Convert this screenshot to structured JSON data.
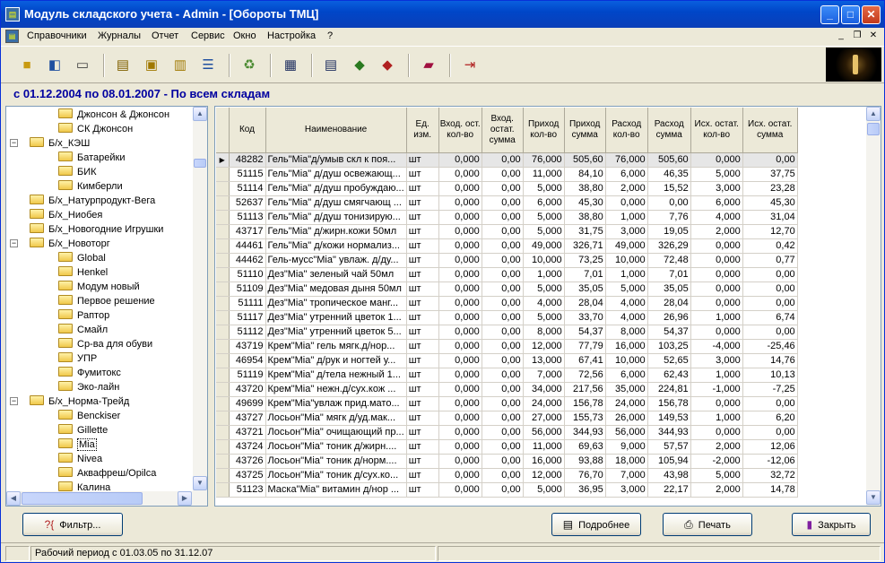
{
  "window": {
    "title": "Модуль складского учета - Admin - [Обороты ТМЦ]"
  },
  "menu": [
    "Справочники",
    "Журналы",
    "Отчет",
    "Сервис",
    "Окно",
    "Настройка",
    "?"
  ],
  "period": "с 01.12.2004 по 08.01.2007 - По всем складам",
  "tree": [
    {
      "label": "Джонсон & Джонсон",
      "level": 3,
      "folder": true
    },
    {
      "label": "СК Джонсон",
      "level": 3,
      "folder": true
    },
    {
      "label": "Б/х_КЭШ",
      "level": 2,
      "folder": true,
      "expander": "−"
    },
    {
      "label": "Батарейки",
      "level": 3,
      "folder": true
    },
    {
      "label": "БИК",
      "level": 3,
      "folder": true
    },
    {
      "label": "Кимберли",
      "level": 3,
      "folder": true
    },
    {
      "label": "Б/х_Натурпродукт-Вега",
      "level": 2,
      "folder": true
    },
    {
      "label": "Б/х_Ниобея",
      "level": 2,
      "folder": true
    },
    {
      "label": "Б/х_Новогодние Игрушки",
      "level": 2,
      "folder": true
    },
    {
      "label": "Б/х_Новоторг",
      "level": 2,
      "folder": true,
      "expander": "−"
    },
    {
      "label": "Global",
      "level": 3,
      "folder": true
    },
    {
      "label": "Henkel",
      "level": 3,
      "folder": true
    },
    {
      "label": "Модум новый",
      "level": 3,
      "folder": true
    },
    {
      "label": "Первое решение",
      "level": 3,
      "folder": true
    },
    {
      "label": "Раптор",
      "level": 3,
      "folder": true
    },
    {
      "label": "Смайл",
      "level": 3,
      "folder": true
    },
    {
      "label": "Ср-ва для обуви",
      "level": 3,
      "folder": true
    },
    {
      "label": "УПР",
      "level": 3,
      "folder": true
    },
    {
      "label": "Фумитокс",
      "level": 3,
      "folder": true
    },
    {
      "label": "Эко-лайн",
      "level": 3,
      "folder": true
    },
    {
      "label": "Б/х_Норма-Трейд",
      "level": 2,
      "folder": true,
      "expander": "−"
    },
    {
      "label": "Benckiser",
      "level": 3,
      "folder": true
    },
    {
      "label": "Gillette",
      "level": 3,
      "folder": true
    },
    {
      "label": "Mia",
      "level": 3,
      "folder": true,
      "selected": true
    },
    {
      "label": "Nivea",
      "level": 3,
      "folder": true
    },
    {
      "label": "Аквафреш/Opilca",
      "level": 3,
      "folder": true
    },
    {
      "label": "Калина",
      "level": 3,
      "folder": true
    }
  ],
  "table": {
    "columns": [
      "Код",
      "Наименование",
      "Ед. изм.",
      "Вход. ост. кол-во",
      "Вход. остат. сумма",
      "Приход кол-во",
      "Приход сумма",
      "Расход кол-во",
      "Расход сумма",
      "Исх. остат. кол-во",
      "Исх. остат. сумма"
    ],
    "rows": [
      [
        "48282",
        "Гель\"Mia\"д/умыв скл к поя...",
        "шт",
        "0,000",
        "0,00",
        "76,000",
        "505,60",
        "76,000",
        "505,60",
        "0,000",
        "0,00"
      ],
      [
        "51115",
        "Гель\"Mia\" д/душ освежающ...",
        "шт",
        "0,000",
        "0,00",
        "11,000",
        "84,10",
        "6,000",
        "46,35",
        "5,000",
        "37,75"
      ],
      [
        "51114",
        "Гель\"Mia\" д/душ пробуждаю...",
        "шт",
        "0,000",
        "0,00",
        "5,000",
        "38,80",
        "2,000",
        "15,52",
        "3,000",
        "23,28"
      ],
      [
        "52637",
        "Гель\"Mia\" д/душ смягчающ ...",
        "шт",
        "0,000",
        "0,00",
        "6,000",
        "45,30",
        "0,000",
        "0,00",
        "6,000",
        "45,30"
      ],
      [
        "51113",
        "Гель\"Mia\" д/душ тонизирую...",
        "шт",
        "0,000",
        "0,00",
        "5,000",
        "38,80",
        "1,000",
        "7,76",
        "4,000",
        "31,04"
      ],
      [
        "43717",
        "Гель\"Mia\" д/жирн.кожи 50мл",
        "шт",
        "0,000",
        "0,00",
        "5,000",
        "31,75",
        "3,000",
        "19,05",
        "2,000",
        "12,70"
      ],
      [
        "44461",
        "Гель\"Mia\" д/кожи нормализ...",
        "шт",
        "0,000",
        "0,00",
        "49,000",
        "326,71",
        "49,000",
        "326,29",
        "0,000",
        "0,42"
      ],
      [
        "44462",
        "Гель-мусс\"Mia\" увлаж. д/ду...",
        "шт",
        "0,000",
        "0,00",
        "10,000",
        "73,25",
        "10,000",
        "72,48",
        "0,000",
        "0,77"
      ],
      [
        "51110",
        "Дез\"Mia\" зеленый чай 50мл",
        "шт",
        "0,000",
        "0,00",
        "1,000",
        "7,01",
        "1,000",
        "7,01",
        "0,000",
        "0,00"
      ],
      [
        "51109",
        "Дез\"Mia\" медовая дыня 50мл",
        "шт",
        "0,000",
        "0,00",
        "5,000",
        "35,05",
        "5,000",
        "35,05",
        "0,000",
        "0,00"
      ],
      [
        "51111",
        "Дез\"Mia\" тропическое манг...",
        "шт",
        "0,000",
        "0,00",
        "4,000",
        "28,04",
        "4,000",
        "28,04",
        "0,000",
        "0,00"
      ],
      [
        "51117",
        "Дез\"Mia\" утренний цветок 1...",
        "шт",
        "0,000",
        "0,00",
        "5,000",
        "33,70",
        "4,000",
        "26,96",
        "1,000",
        "6,74"
      ],
      [
        "51112",
        "Дез\"Mia\" утренний цветок 5...",
        "шт",
        "0,000",
        "0,00",
        "8,000",
        "54,37",
        "8,000",
        "54,37",
        "0,000",
        "0,00"
      ],
      [
        "43719",
        "Крем\"Mia\" гель мягк.д/нор...",
        "шт",
        "0,000",
        "0,00",
        "12,000",
        "77,79",
        "16,000",
        "103,25",
        "-4,000",
        "-25,46"
      ],
      [
        "46954",
        "Крем\"Mia\" д/рук и ногтей у...",
        "шт",
        "0,000",
        "0,00",
        "13,000",
        "67,41",
        "10,000",
        "52,65",
        "3,000",
        "14,76"
      ],
      [
        "51119",
        "Крем\"Mia\" д/тела нежный 1...",
        "шт",
        "0,000",
        "0,00",
        "7,000",
        "72,56",
        "6,000",
        "62,43",
        "1,000",
        "10,13"
      ],
      [
        "43720",
        "Крем\"Mia\" нежн.д/сух.кож ...",
        "шт",
        "0,000",
        "0,00",
        "34,000",
        "217,56",
        "35,000",
        "224,81",
        "-1,000",
        "-7,25"
      ],
      [
        "49699",
        "Крем\"Mia\"увлаж прид.мато...",
        "шт",
        "0,000",
        "0,00",
        "24,000",
        "156,78",
        "24,000",
        "156,78",
        "0,000",
        "0,00"
      ],
      [
        "43727",
        "Лосьон\"Mia\" мягк д/уд.мак...",
        "шт",
        "0,000",
        "0,00",
        "27,000",
        "155,73",
        "26,000",
        "149,53",
        "1,000",
        "6,20"
      ],
      [
        "43721",
        "Лосьон\"Mia\" очищающий пр...",
        "шт",
        "0,000",
        "0,00",
        "56,000",
        "344,93",
        "56,000",
        "344,93",
        "0,000",
        "0,00"
      ],
      [
        "43724",
        "Лосьон\"Mia\" тоник д/жирн....",
        "шт",
        "0,000",
        "0,00",
        "11,000",
        "69,63",
        "9,000",
        "57,57",
        "2,000",
        "12,06"
      ],
      [
        "43726",
        "Лосьон\"Mia\" тоник д/норм....",
        "шт",
        "0,000",
        "0,00",
        "16,000",
        "93,88",
        "18,000",
        "105,94",
        "-2,000",
        "-12,06"
      ],
      [
        "43725",
        "Лосьон\"Mia\" тоник д/сух.ко...",
        "шт",
        "0,000",
        "0,00",
        "12,000",
        "76,70",
        "7,000",
        "43,98",
        "5,000",
        "32,72"
      ],
      [
        "51123",
        "Маска\"Mia\" витамин д/нор ...",
        "шт",
        "0,000",
        "0,00",
        "5,000",
        "36,95",
        "3,000",
        "22,17",
        "2,000",
        "14,78"
      ]
    ]
  },
  "buttons": {
    "filter": "Фильтр...",
    "details": "Подробнее",
    "print": "Печать",
    "close": "Закрыть"
  },
  "status": {
    "left": "",
    "work_period": "Рабочий период с 01.03.05 по 31.12.07",
    "right": ""
  }
}
